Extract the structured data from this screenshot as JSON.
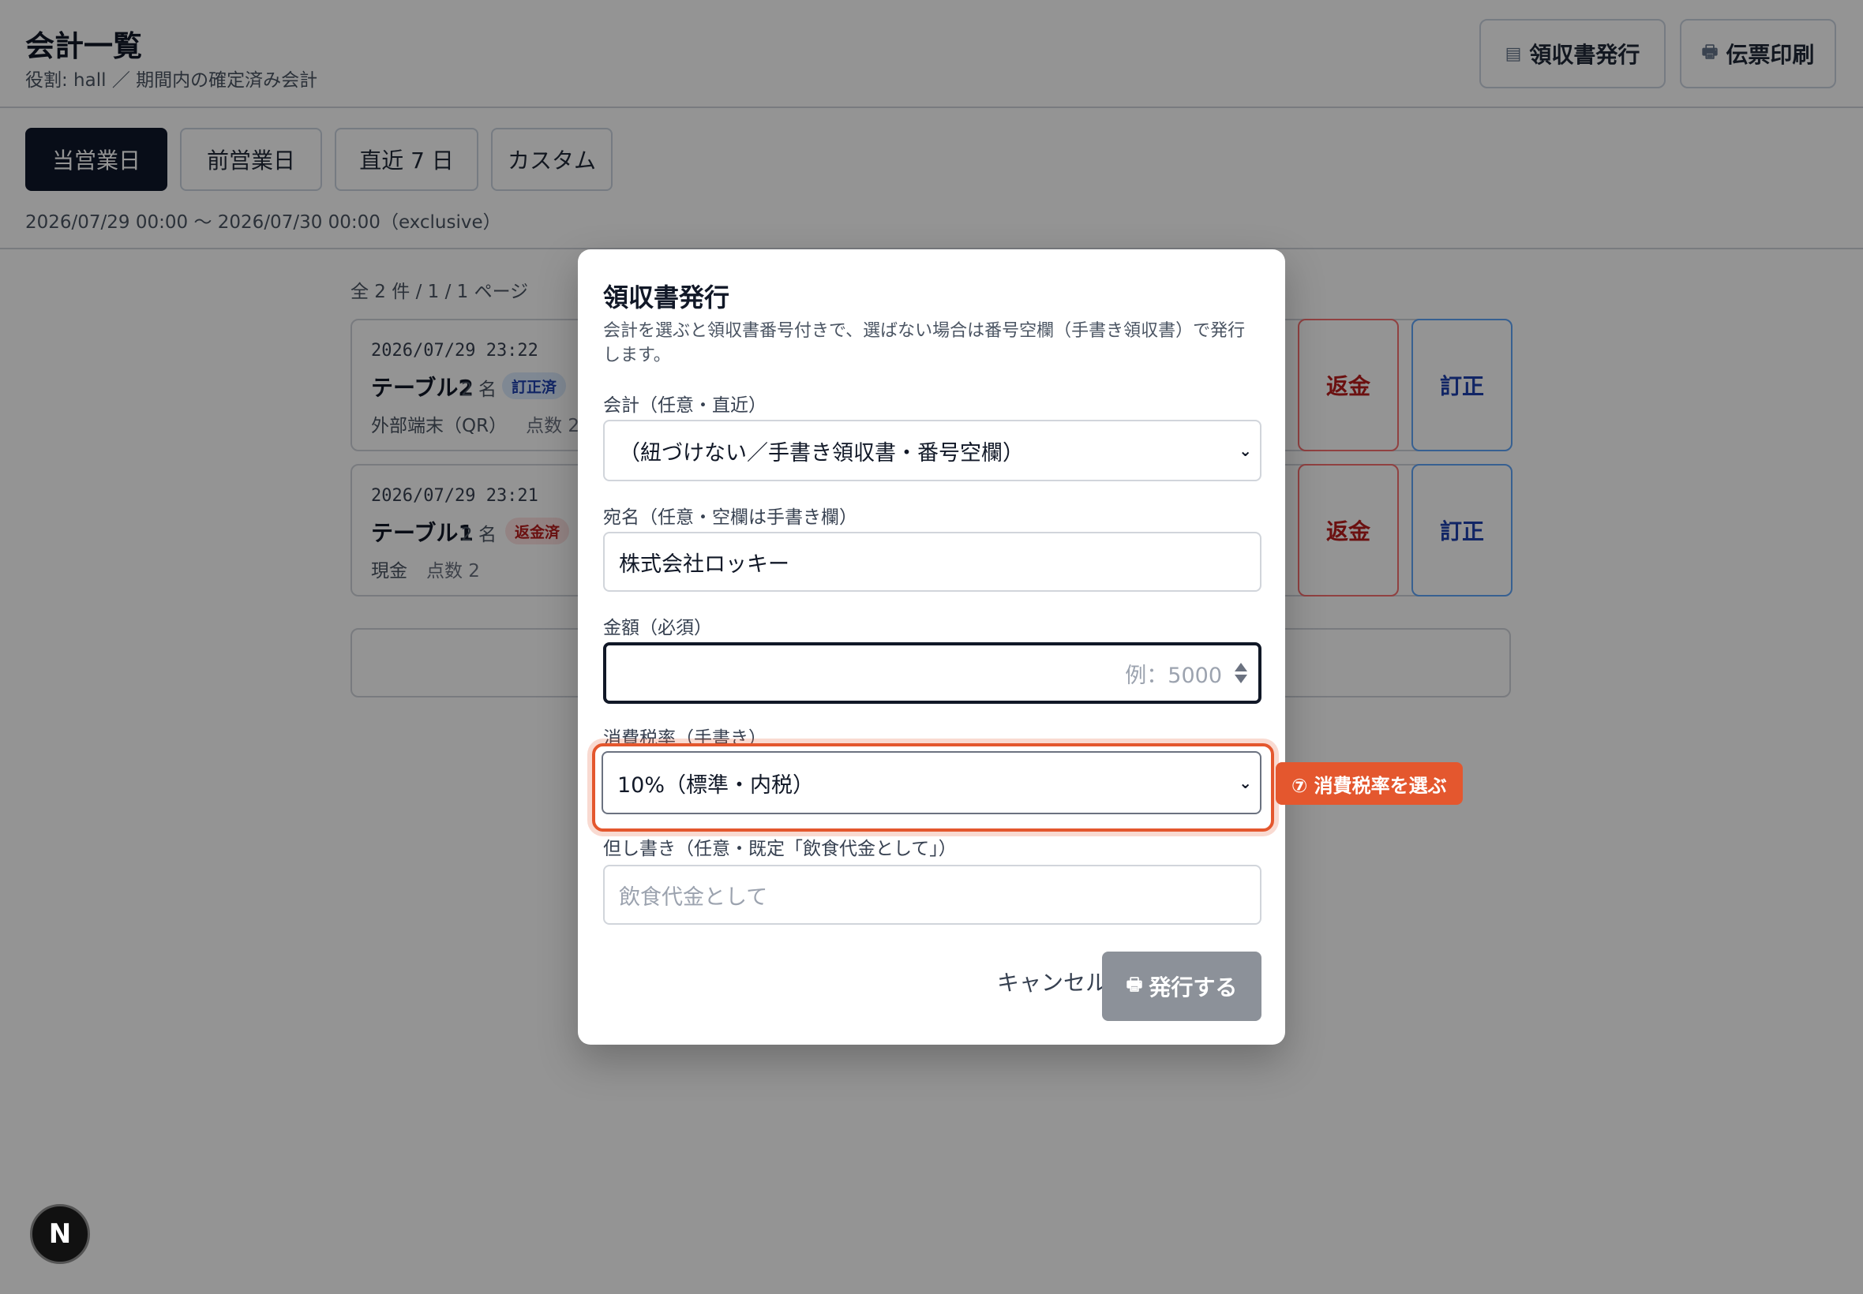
{
  "header": {
    "title": "会計一覧",
    "subtitle": "役割: hall ／ 期間内の確定済み会計",
    "receipt_button": "領収書発行",
    "receipt_icon": "receipt-icon",
    "print_button": "伝票印刷",
    "print_icon": "printer-icon"
  },
  "period": {
    "tabs": [
      {
        "label": "当営業日",
        "active": true
      },
      {
        "label": "前営業日",
        "active": false
      },
      {
        "label": "直近 7 日",
        "active": false
      },
      {
        "label": "カスタム",
        "active": false
      }
    ],
    "range": "2026/07/29 00:00 〜 2026/07/30 00:00（exclusive）"
  },
  "list": {
    "count": "全 2 件 / 1 / 1 ページ",
    "rows": [
      {
        "datetime": "2026/07/29 23:22",
        "table": "テーブル2",
        "people": "2 名",
        "badge": "訂正済",
        "badge_color": "#1e40af",
        "payment": "外部端末（QR）",
        "points": "点数 2",
        "refund": "返金",
        "fix": "訂正"
      },
      {
        "datetime": "2026/07/29 23:21",
        "table": "テーブル1",
        "people": "2 名",
        "badge": "返金済",
        "badge_color": "#b91c1c",
        "payment": "現金",
        "points": "点数 2",
        "refund": "返金",
        "fix": "訂正"
      }
    ]
  },
  "modal": {
    "title": "領収書発行",
    "description": "会計を選ぶと領収書番号付きで、選ばない場合は番号空欄（手書き領収書）で発行します。",
    "account_label": "会計（任意・直近）",
    "account_value": "（紐づけない／手書き領収書・番号空欄）",
    "name_label": "宛名（任意・空欄は手書き欄）",
    "name_value": "株式会社ロッキー",
    "amount_label": "金額（必須）",
    "amount_placeholder": "例：5000",
    "tax_label": "消費税率（手書き）",
    "tax_value": "10%（標準・内税）",
    "memo_label": "但し書き（任意・既定「飲食代金として」）",
    "memo_placeholder": "飲食代金として",
    "cancel": "キャンセル",
    "issue": "発行する",
    "issue_icon": "printer-icon"
  },
  "callout": "⑦ 消費税率を選ぶ",
  "dev_badge": "N",
  "colors": {
    "accent": "#e4572e",
    "primary": "#0f172a",
    "refund": "#b91c1c",
    "fix": "#1e40af"
  }
}
